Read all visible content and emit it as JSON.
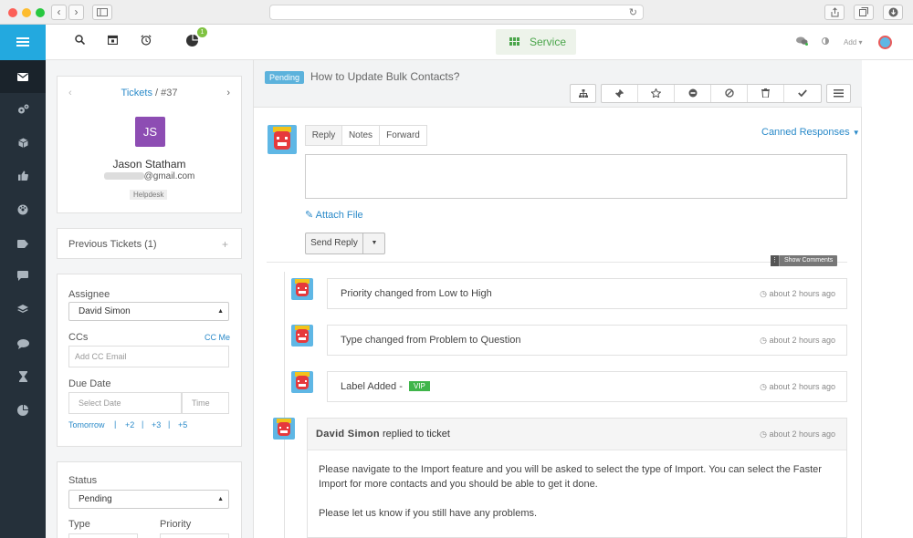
{
  "browser": {
    "back": "‹",
    "forward": "›",
    "reload": "↻"
  },
  "sidebar": {
    "items": [
      {
        "name": "inbox-icon"
      },
      {
        "name": "gears-icon"
      },
      {
        "name": "box-icon"
      },
      {
        "name": "thumbs-up-icon"
      },
      {
        "name": "dashboard-icon"
      },
      {
        "name": "tag-icon"
      },
      {
        "name": "chat-icon"
      },
      {
        "name": "layers-icon"
      },
      {
        "name": "comment-icon"
      },
      {
        "name": "hourglass-icon"
      },
      {
        "name": "pie-chart-icon"
      }
    ]
  },
  "topbar": {
    "notification_count": "1",
    "service_label": "Service",
    "add_label": "Add"
  },
  "ticket": {
    "breadcrumb_link": "Tickets",
    "breadcrumb_id": " / #37",
    "customer_initials": "JS",
    "customer_name": "Jason Statham",
    "customer_email_visible": "@gmail.com",
    "customer_tag": "Helpdesk",
    "previous_tickets": "Previous Tickets (1)"
  },
  "properties": {
    "assignee_label": "Assignee",
    "assignee_value": "David Simon",
    "ccs_label": "CCs",
    "cc_me": "CC Me",
    "cc_placeholder": "Add CC Email",
    "due_date_label": "Due Date",
    "select_date_placeholder": "Select Date",
    "time_placeholder": "Time",
    "quick_dates": [
      "Tomorrow",
      "+2",
      "+3",
      "+5"
    ],
    "status_label": "Status",
    "status_value": "Pending",
    "type_label": "Type",
    "priority_label": "Priority"
  },
  "header": {
    "status_tag": "Pending",
    "subject": "How to Update Bulk Contacts?"
  },
  "reply": {
    "tabs": [
      "Reply",
      "Notes",
      "Forward"
    ],
    "canned": "Canned Responses",
    "attach": "Attach File",
    "send": "Send Reply",
    "show_comments": "Show Comments"
  },
  "events": [
    {
      "text": "Priority changed from Low to High",
      "time": "about 2 hours ago"
    },
    {
      "text": "Type changed from Problem to Question",
      "time": "about 2 hours ago"
    },
    {
      "text": "Label Added - ",
      "tag": "VIP",
      "time": "about 2 hours ago"
    }
  ],
  "reply_post": {
    "author": "David Simon",
    "action": " replied to ticket",
    "time": "about 2 hours ago",
    "paragraphs": [
      "Please navigate to the Import feature and you will be asked to select the type of Import. You can select the Faster Import for more contacts and you should be able to get it done.",
      "Please let us know if you still have any problems."
    ]
  }
}
